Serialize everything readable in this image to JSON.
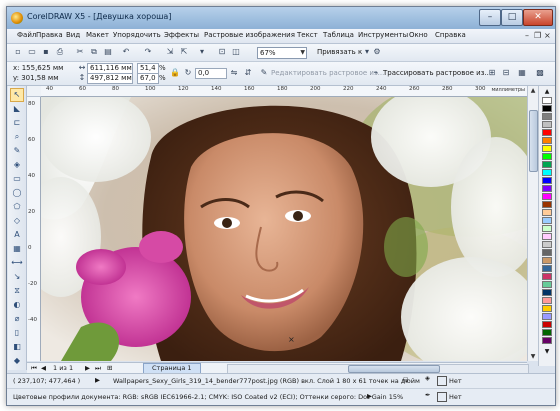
{
  "window": {
    "title": "CorelDRAW X5 - [Девушка хороша]",
    "buttons": {
      "minimize": "–",
      "maximize": "□",
      "close": "✕"
    }
  },
  "menu": {
    "items": [
      "Файл",
      "Правка",
      "Вид",
      "Макет",
      "Упорядочить",
      "Эффекты",
      "Растровые изображения",
      "Текст",
      "Таблица",
      "Инструменты",
      "Окно",
      "Справка"
    ]
  },
  "toolbar": {
    "zoom_value": "67%",
    "snap_label": "Привязать к"
  },
  "property_bar": {
    "x": "x: 155,625 мм",
    "y": "y: 301,58 мм",
    "width": "611,116 мм",
    "height": "497,812 мм",
    "scale_x": "51,4",
    "scale_y": "67,0",
    "percent_x": "%",
    "percent_y": "%",
    "rotation": "0,0",
    "edit_bitmap": "Редактировать растровое из...",
    "trace_bitmap": "Трассировать растровое из..."
  },
  "ruler": {
    "h_labels": [
      "40",
      "60",
      "80",
      "100",
      "120",
      "140",
      "160",
      "180",
      "200",
      "220",
      "240",
      "260",
      "280",
      "300"
    ],
    "unit": "миллиметры",
    "v_labels": [
      "80",
      "60",
      "40",
      "20",
      "0",
      "-20",
      "-40"
    ]
  },
  "pagebar": {
    "page_count": "1 из 1",
    "page_tab": "Страница 1"
  },
  "status": {
    "cursor": "( 237,107; 477,464 )",
    "object_info": "Wallpapers_Sexy_Girls_319_14_bender777post.jpg (RGB) вкл. Слой 1 80 x 61 точек на дюйм",
    "color_profile": "Цветовые профили документа: RGB: sRGB IEC61966-2.1; CMYK: ISO Coated v2 (ECI); Оттенки серого: Dot Gain 15%",
    "fill": "Нет",
    "outline": "Нет"
  },
  "colors": {
    "titlebar": "#9fbfdf",
    "palette": [
      "#ffffff",
      "#000000",
      "#7f7f7f",
      "#c0c0c0",
      "#ff0000",
      "#ff7f00",
      "#ffff00",
      "#00ff00",
      "#00a651",
      "#00ffff",
      "#0000ff",
      "#7f00ff",
      "#ff00ff",
      "#993300",
      "#ffcc99",
      "#99ccff",
      "#ccffcc",
      "#ffccff",
      "#cccccc",
      "#666666",
      "#cc9966",
      "#336699",
      "#cc3366",
      "#66cc99",
      "#003366",
      "#ff9999",
      "#ffcc00",
      "#9999ff",
      "#cc0000",
      "#006600",
      "#660066"
    ]
  }
}
